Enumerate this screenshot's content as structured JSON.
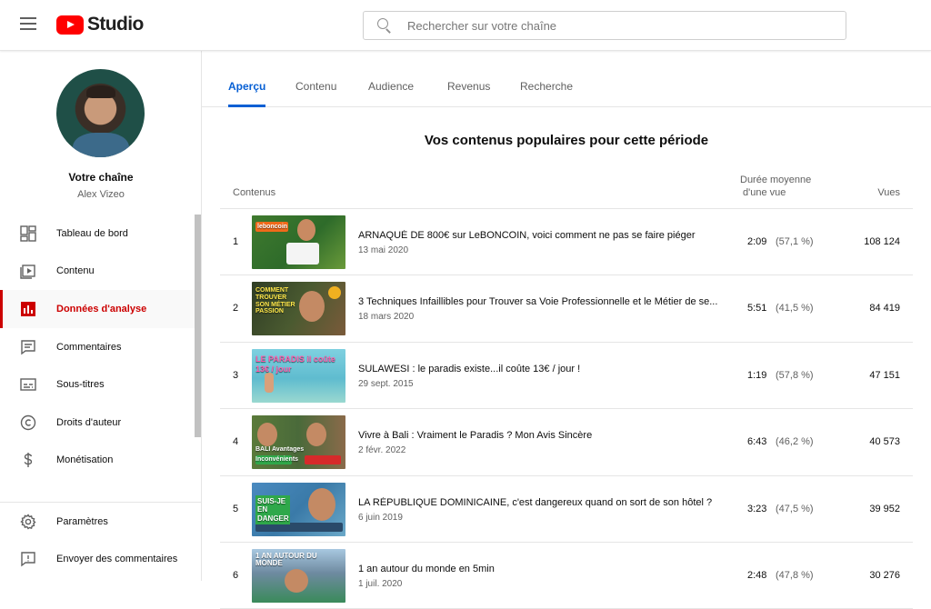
{
  "header": {
    "logo_text": "Studio",
    "search_placeholder": "Rechercher sur votre chaîne"
  },
  "sidebar": {
    "channel_title": "Votre chaîne",
    "channel_name": "Alex Vizeo",
    "items": [
      {
        "label": "Tableau de bord",
        "icon": "dashboard-icon"
      },
      {
        "label": "Contenu",
        "icon": "content-icon"
      },
      {
        "label": "Données d'analyse",
        "icon": "analytics-icon",
        "active": true
      },
      {
        "label": "Commentaires",
        "icon": "comments-icon"
      },
      {
        "label": "Sous-titres",
        "icon": "subtitles-icon"
      },
      {
        "label": "Droits d'auteur",
        "icon": "copyright-icon"
      },
      {
        "label": "Monétisation",
        "icon": "monetization-icon"
      }
    ],
    "bottom_items": [
      {
        "label": "Paramètres",
        "icon": "settings-icon"
      },
      {
        "label": "Envoyer des commentaires",
        "icon": "feedback-icon"
      }
    ]
  },
  "tabs": [
    {
      "label": "Aperçu",
      "active": true
    },
    {
      "label": "Contenu"
    },
    {
      "label": "Audience"
    },
    {
      "label": "Revenus"
    },
    {
      "label": "Recherche"
    }
  ],
  "section_title": "Vos contenus populaires pour cette période",
  "table": {
    "col_content": "Contenus",
    "col_duration_line1": "Durée moyenne",
    "col_duration_line2": "d'une vue",
    "col_views": "Vues",
    "rows": [
      {
        "rank": "1",
        "title": "ARNAQUÉ DE 800€ sur LeBONCOIN, voici comment ne pas se faire piéger",
        "date": "13 mai 2020",
        "duration": "2:09",
        "percent": "(57,1 %)",
        "views": "108 124",
        "thumb_text": "leboncoin",
        "thumb_color": "#2e6b2a"
      },
      {
        "rank": "2",
        "title": "3 Techniques Infaillibles pour Trouver sa Voie Professionnelle et le Métier de se...",
        "date": "18 mars 2020",
        "duration": "5:51",
        "percent": "(41,5 %)",
        "views": "84 419",
        "thumb_text": "COMMENT TROUVER SON MÉTIER PASSION",
        "thumb_color": "#3d4a2a"
      },
      {
        "rank": "3",
        "title": "SULAWESI : le paradis existe...il coûte 13€ / jour !",
        "date": "29 sept. 2015",
        "duration": "1:19",
        "percent": "(57,8 %)",
        "views": "47 151",
        "thumb_text": "LE PARADIS il coûte 13€ / jour",
        "thumb_color": "#5fbccf"
      },
      {
        "rank": "4",
        "title": "Vivre à Bali : Vraiment le Paradis ? Mon Avis Sincère",
        "date": "2 févr. 2022",
        "duration": "6:43",
        "percent": "(46,2 %)",
        "views": "40 573",
        "thumb_text": "BALI Avantages Inconvénients",
        "thumb_color": "#4a6a3a"
      },
      {
        "rank": "5",
        "title": "LA RÉPUBLIQUE DOMINICAINE, c'est dangereux quand on sort de son hôtel ?",
        "date": "6 juin 2019",
        "duration": "3:23",
        "percent": "(47,5 %)",
        "views": "39 952",
        "thumb_text": "SUIS-JE EN DANGER",
        "thumb_color": "#3a7aa8"
      },
      {
        "rank": "6",
        "title": "1 an autour du monde en 5min",
        "date": "1 juil. 2020",
        "duration": "2:48",
        "percent": "(47,8 %)",
        "views": "30 276",
        "thumb_text": "1 AN AUTOUR DU MONDE",
        "thumb_color": "#6e8aa0"
      }
    ]
  }
}
